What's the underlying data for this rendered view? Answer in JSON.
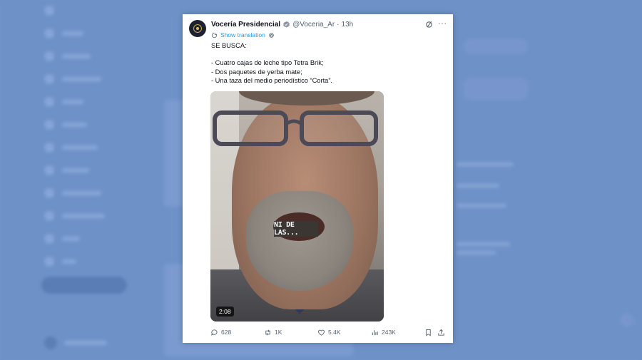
{
  "tweet": {
    "author_name": "Vocería Presidencial",
    "handle": "@Voceria_Ar",
    "separator": "·",
    "time": "13h",
    "show_translation": "Show translation",
    "body_lines": [
      "SE BUSCA:",
      "",
      "- Cuatro cajas de leche tipo Tetra Brik;",
      "- Dos paquetes de yerba mate;",
      "- Una taza del medio periodístico “Corta”."
    ],
    "video": {
      "caption": "NI DE LAS...",
      "duration": "2:08"
    },
    "actions": {
      "replies": "628",
      "reposts": "1K",
      "likes": "5.4K",
      "views": "243K"
    },
    "more_label": "···"
  },
  "icons": {
    "verified": "verified-badge-icon",
    "grok": "grok-icon",
    "more": "more-icon",
    "translate": "translate-icon",
    "settings": "gear-icon",
    "reply": "reply-icon",
    "repost": "repost-icon",
    "like": "heart-icon",
    "views": "views-icon",
    "bookmark": "bookmark-icon",
    "share": "share-icon"
  },
  "colors": {
    "accent": "#1d9bf0",
    "text": "#0f1419",
    "muted": "#536471",
    "backdrop": "#6f93c9"
  }
}
